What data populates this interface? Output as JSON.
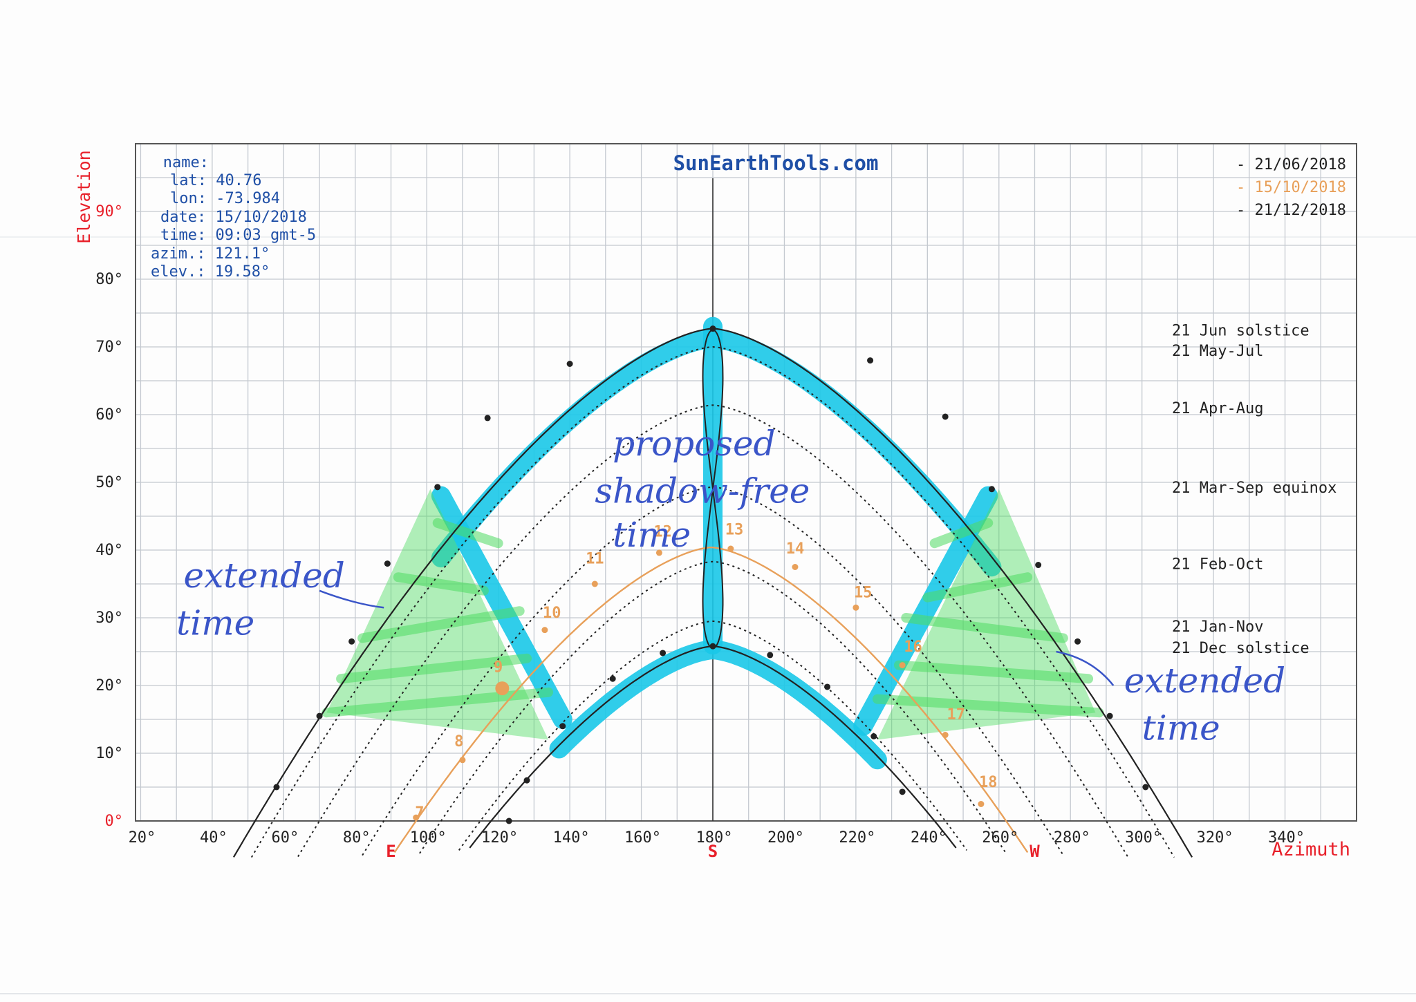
{
  "colors": {
    "grid": "#c4c9d0",
    "frame": "#555555",
    "red": "#e8202a",
    "blue": "#1f4fa6",
    "orange": "#e8a05a",
    "black": "#222222",
    "cyan": "#19c8e8",
    "green": "#4fdc63",
    "ink": "#3a55c8"
  },
  "chart_data": {
    "type": "line",
    "title": "SunEarthTools.com",
    "xlabel": "Azimuth",
    "ylabel": "Elevation",
    "xlim": [
      0,
      360
    ],
    "ylim": [
      0,
      90
    ],
    "x_ticks": [
      "20°",
      "40°",
      "60°",
      "80°",
      "100°",
      "120°",
      "140°",
      "160°",
      "180°",
      "200°",
      "220°",
      "240°",
      "260°",
      "280°",
      "300°",
      "320°",
      "340°"
    ],
    "y_ticks": [
      "0°",
      "10°",
      "20°",
      "30°",
      "40°",
      "50°",
      "60°",
      "70°",
      "80°",
      "90°"
    ],
    "compass": [
      {
        "label": "E",
        "azimuth": 90
      },
      {
        "label": "S",
        "azimuth": 180
      },
      {
        "label": "W",
        "azimuth": 270
      }
    ],
    "info": {
      "name": "name:",
      "lat": "lat: 40.76",
      "lon": "lon: -73.984",
      "date": "date: 15/10/2018",
      "time": "time: 09:03 gmt-5",
      "azim": "azim.: 121.1°",
      "elev": "elev.: 19.58°"
    },
    "legend": [
      {
        "label": "- 21/06/2018",
        "color": "#222222"
      },
      {
        "label": "- 15/10/2018",
        "color": "#e8a05a"
      },
      {
        "label": "- 21/12/2018",
        "color": "#222222"
      }
    ],
    "path_labels": [
      {
        "label": "21 Jun  solstice",
        "elevation": 72.5
      },
      {
        "label": "21 May-Jul",
        "elevation": 69.5
      },
      {
        "label": "21 Apr-Aug",
        "elevation": 61
      },
      {
        "label": "21 Mar-Sep equinox",
        "elevation": 49.3
      },
      {
        "label": "21 Feb-Oct",
        "elevation": 38
      },
      {
        "label": "21 Jan-Nov",
        "elevation": 28.8
      },
      {
        "label": "21 Dec  solstice",
        "elevation": 25.6
      }
    ],
    "sun_position": {
      "azimuth": 121.1,
      "elevation": 19.58,
      "label": "9"
    },
    "series": [
      {
        "name": "21/06/2018",
        "max_elevation": 72.7,
        "az_range": [
          52,
          308
        ],
        "style": "solid",
        "markers": [
          [
            58,
            5
          ],
          [
            70,
            15.5
          ],
          [
            79,
            26.5
          ],
          [
            89,
            38
          ],
          [
            103,
            49.3
          ],
          [
            117,
            59.5
          ],
          [
            140,
            67.5
          ],
          [
            180,
            72.7
          ],
          [
            224,
            68
          ],
          [
            245,
            59.7
          ],
          [
            258,
            49
          ],
          [
            271,
            37.8
          ],
          [
            282,
            26.5
          ],
          [
            291,
            15.5
          ],
          [
            301,
            5
          ]
        ]
      },
      {
        "name": "21 May-Jul",
        "max_elevation": 70.0,
        "az_range": [
          57,
          303
        ],
        "style": "dotted",
        "markers": []
      },
      {
        "name": "21 Apr-Aug",
        "max_elevation": 61.4,
        "az_range": [
          70,
          290
        ],
        "style": "dotted",
        "markers": []
      },
      {
        "name": "21 Mar-Sep",
        "max_elevation": 49.3,
        "az_range": [
          88,
          272
        ],
        "style": "dotted",
        "markers": []
      },
      {
        "name": "15/10/2018",
        "max_elevation": 40.4,
        "az_range": [
          97,
          262
        ],
        "style": "orange",
        "markers": [
          [
            97,
            0.5
          ],
          [
            110,
            9
          ],
          [
            121,
            19.6
          ],
          [
            133,
            28.2
          ],
          [
            147,
            35
          ],
          [
            165,
            39.6
          ],
          [
            185,
            40.2
          ],
          [
            203,
            37.5
          ],
          [
            220,
            31.5
          ],
          [
            233,
            23
          ],
          [
            245,
            12.7
          ],
          [
            255,
            2.5
          ]
        ]
      },
      {
        "name": "21 Feb-Oct",
        "max_elevation": 38.3,
        "az_range": [
          104,
          256
        ],
        "style": "dotted",
        "markers": []
      },
      {
        "name": "21 Jan-Nov",
        "max_elevation": 29.5,
        "az_range": [
          115,
          245
        ],
        "style": "dotted",
        "markers": []
      },
      {
        "name": "21/12/2018",
        "max_elevation": 25.8,
        "az_range": [
          118,
          242
        ],
        "style": "solid",
        "markers": [
          [
            123,
            0
          ],
          [
            128,
            6
          ],
          [
            138,
            14
          ],
          [
            152,
            21
          ],
          [
            166,
            24.8
          ],
          [
            180,
            25.8
          ],
          [
            196,
            24.5
          ],
          [
            212,
            19.8
          ],
          [
            225,
            12.5
          ],
          [
            233,
            4.3
          ]
        ]
      }
    ],
    "hour_labels": [
      {
        "label": "7",
        "azimuth": 98,
        "elevation": 0.5
      },
      {
        "label": "8",
        "azimuth": 109,
        "elevation": 11
      },
      {
        "label": "9",
        "azimuth": 120,
        "elevation": 22
      },
      {
        "label": "10",
        "azimuth": 135,
        "elevation": 30
      },
      {
        "label": "11",
        "azimuth": 147,
        "elevation": 38
      },
      {
        "label": "12",
        "azimuth": 166,
        "elevation": 42
      },
      {
        "label": "13",
        "azimuth": 186,
        "elevation": 42.3
      },
      {
        "label": "14",
        "azimuth": 203,
        "elevation": 39.5
      },
      {
        "label": "15",
        "azimuth": 222,
        "elevation": 33
      },
      {
        "label": "16",
        "azimuth": 236,
        "elevation": 25
      },
      {
        "label": "17",
        "azimuth": 248,
        "elevation": 15
      },
      {
        "label": "18",
        "azimuth": 257,
        "elevation": 5
      }
    ],
    "annotations": [
      {
        "text": "proposed",
        "azimuth": 152,
        "elevation": 54
      },
      {
        "text": "shadow-free",
        "azimuth": 147,
        "elevation": 47
      },
      {
        "text": "time",
        "azimuth": 152,
        "elevation": 40.5
      },
      {
        "text": "extended",
        "azimuth": 32,
        "elevation": 34.5
      },
      {
        "text": "time",
        "azimuth": 30,
        "elevation": 27.5
      },
      {
        "text": "extended",
        "azimuth": 295,
        "elevation": 19
      },
      {
        "text": "time",
        "azimuth": 300,
        "elevation": 12
      }
    ]
  }
}
